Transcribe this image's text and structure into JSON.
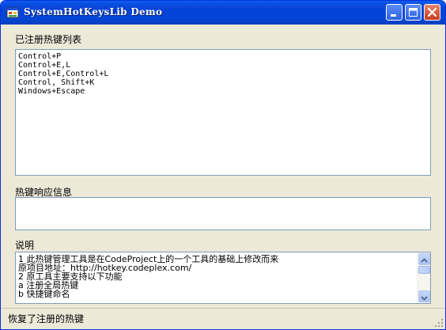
{
  "window": {
    "title": "SystemHotKeysLib Demo",
    "controls": {
      "minimize": "minimize",
      "maximize": "maximize",
      "close": "close"
    }
  },
  "hotkeys_section": {
    "label": "已注册热键列表",
    "items": [
      "Control+P",
      "Control+E,L",
      "Control+E,Control+L",
      "Control, Shift+K",
      "Windows+Escape"
    ]
  },
  "response_section": {
    "label": "热键响应信息",
    "value": ""
  },
  "notes_section": {
    "label": "说明",
    "lines": [
      "1 此热键管理工具是在CodeProject上的一个工具的基础上修改而来",
      "   原项目地址：http://hotkey.codeplex.com/",
      "2 原工具主要支持以下功能",
      "    a 注册全局热键",
      "    b 快捷键命名"
    ]
  },
  "status_bar": {
    "text": "恢复了注册的热键"
  },
  "colors": {
    "title_bar": "#0a5ff4",
    "window_bg": "#ece9d8",
    "field_border": "#7f9db9",
    "close_button": "#c63a1e"
  },
  "icons": [
    "app-icon",
    "minimize-icon",
    "maximize-icon",
    "close-icon",
    "scroll-up-icon",
    "scroll-down-icon",
    "resize-grip-icon"
  ]
}
